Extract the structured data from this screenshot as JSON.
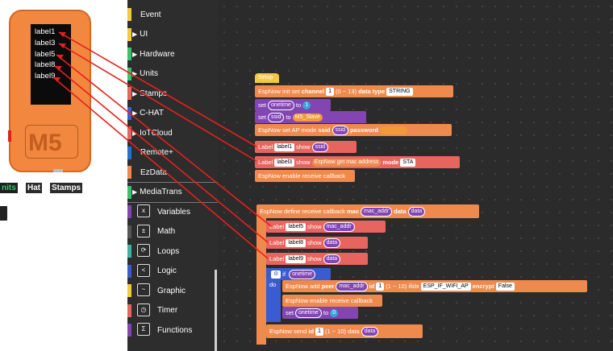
{
  "device": {
    "labels": [
      "label1",
      "label3",
      "label5",
      "label8",
      "label9"
    ],
    "logo": "M5"
  },
  "left_tabs": {
    "units": "nits",
    "hat": "Hat",
    "stamps": "Stamps"
  },
  "categories": [
    {
      "label": "Event",
      "color": "#f5c842"
    },
    {
      "label": "UI",
      "color": "#f5c842",
      "arrow": true
    },
    {
      "label": "Hardware",
      "color": "#37c46b",
      "arrow": true
    },
    {
      "label": "Units",
      "color": "#37c46b",
      "arrow": true
    },
    {
      "label": "Stamps",
      "color": "#e8655f",
      "arrow": true
    },
    {
      "label": "C-HAT",
      "color": "#3b5bd1",
      "arrow": true
    },
    {
      "label": "IoTCloud",
      "color": "#e8655f",
      "arrow": true
    },
    {
      "label": "Remote+",
      "color": "#1e74d6"
    },
    {
      "label": "EzData",
      "color": "#ef8a4e"
    },
    {
      "label": "MediaTrans",
      "color": "#37c46b",
      "arrow": true
    },
    {
      "label": "Variables",
      "color": "#8245b2",
      "icon": "x-icon"
    },
    {
      "label": "Math",
      "color": "#555",
      "icon": "math-icon"
    },
    {
      "label": "Loops",
      "color": "#3fb3a0",
      "icon": "loop-icon"
    },
    {
      "label": "Logic",
      "color": "#3b5bd1",
      "icon": "logic-icon"
    },
    {
      "label": "Graphic",
      "color": "#f5c842",
      "icon": "graphic-icon"
    },
    {
      "label": "Timer",
      "color": "#e8655f",
      "icon": "timer-icon"
    },
    {
      "label": "Functions",
      "color": "#8245b2",
      "icon": "function-icon"
    }
  ],
  "blocks": {
    "setup": "Setup",
    "init": {
      "prefix": "EspNow init set",
      "channel": "channel",
      "channel_val": "1",
      "range": "(0 ~ 13)",
      "datatype": "data type",
      "datatype_val": "STRING"
    },
    "set1": {
      "set": "set",
      "var": "onetime",
      "to": "to",
      "val": "1"
    },
    "set2": {
      "set": "set",
      "var": "ssid",
      "to": "to",
      "val": "M5_Slave"
    },
    "ap": {
      "prefix": "EspNow set AP mode",
      "ssid": "ssid",
      "ssid_var": "ssid",
      "password": "password"
    },
    "label1": {
      "label": "Label",
      "name": "label1",
      "show": "show",
      "val": "ssid"
    },
    "label3": {
      "label": "Label",
      "name": "label3",
      "show": "show",
      "val": "EspNow get mac address",
      "mode": "mode",
      "mode_val": "STA"
    },
    "recv1": "EspNow enable receive callback",
    "define": {
      "prefix": "EspNow define receive callback",
      "mac": "mac",
      "mac_val": "mac_addr",
      "data": "data",
      "data_val": "data"
    },
    "label5": {
      "label": "Label",
      "name": "label5",
      "show": "show",
      "val": "mac_addr"
    },
    "label8": {
      "label": "Label",
      "name": "label8",
      "show": "show",
      "val": "data"
    },
    "label9": {
      "label": "Label",
      "name": "label9",
      "show": "show",
      "val": "data"
    },
    "if": {
      "if": "if",
      "cond": "onetime",
      "do": "do"
    },
    "add": {
      "prefix": "EspNow add",
      "peer": "peer",
      "peer_val": "mac_addr",
      "id": "id",
      "id_val": "1",
      "range": "(1 ~ 10) ifidx",
      "ifidx": "ESP_IF_WIFI_AP",
      "encrypt": "encrypt",
      "encrypt_val": "False"
    },
    "recv2": "EspNow enable receive callback",
    "set3": {
      "set": "set",
      "var": "onetime",
      "to": "to",
      "val": "0"
    },
    "send": {
      "prefix": "EspNow send",
      "id": "id",
      "id_val": "1",
      "range": "(1 ~ 10) data",
      "data_val": "data"
    }
  }
}
